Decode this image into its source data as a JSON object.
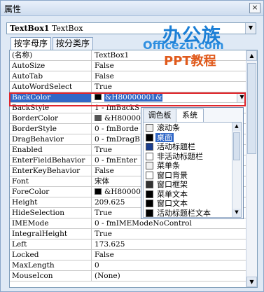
{
  "window": {
    "title": "属性",
    "close_label": "×"
  },
  "object_combo": {
    "name": "TextBox1",
    "type": "TextBox",
    "dropdown": "▼"
  },
  "tabs": [
    {
      "label": "按字母序",
      "active": true
    },
    {
      "label": "按分类序",
      "active": false
    }
  ],
  "properties": [
    {
      "name": "(名称)",
      "value": "TextBox1"
    },
    {
      "name": "AutoSize",
      "value": "False"
    },
    {
      "name": "AutoTab",
      "value": "False"
    },
    {
      "name": "AutoWordSelect",
      "value": "True"
    },
    {
      "name": "BackColor",
      "value": "&H80000001&",
      "swatch": "#000000",
      "selected": true
    },
    {
      "name": "BackStyle",
      "value": "1 - fmBackS"
    },
    {
      "name": "BorderColor",
      "value": "&H8000000",
      "swatch": "#555555"
    },
    {
      "name": "BorderStyle",
      "value": "0 - fmBorde"
    },
    {
      "name": "DragBehavior",
      "value": "0 - fmDragB"
    },
    {
      "name": "Enabled",
      "value": "True"
    },
    {
      "name": "EnterFieldBehavior",
      "value": "0 - fmEnter"
    },
    {
      "name": "EnterKeyBehavior",
      "value": "False"
    },
    {
      "name": "Font",
      "value": "宋体"
    },
    {
      "name": "ForeColor",
      "value": "&H8000000",
      "swatch": "#000000"
    },
    {
      "name": "Height",
      "value": "209.625"
    },
    {
      "name": "HideSelection",
      "value": "True"
    },
    {
      "name": "IMEMode",
      "value": "0 - fmIMEModeNoControl"
    },
    {
      "name": "IntegralHeight",
      "value": "True"
    },
    {
      "name": "Left",
      "value": "173.625"
    },
    {
      "name": "Locked",
      "value": "False"
    },
    {
      "name": "MaxLength",
      "value": "0"
    },
    {
      "name": "MouseIcon",
      "value": "(None)"
    }
  ],
  "color_popup": {
    "tabs": [
      {
        "label": "调色板",
        "active": false
      },
      {
        "label": "系统",
        "active": true
      }
    ],
    "items": [
      {
        "label": "滚动条",
        "color": "#f0f0f0"
      },
      {
        "label": "桌面",
        "color": "#000000",
        "selected": true
      },
      {
        "label": "活动标题栏",
        "color": "#1a3e8f"
      },
      {
        "label": "非活动标题栏",
        "color": "#ffffff"
      },
      {
        "label": "菜单条",
        "color": "#f0f0f0"
      },
      {
        "label": "窗口背景",
        "color": "#ffffff"
      },
      {
        "label": "窗口框架",
        "color": "#333333"
      },
      {
        "label": "菜单文本",
        "color": "#000000"
      },
      {
        "label": "窗口文本",
        "color": "#000000"
      },
      {
        "label": "活动标题栏文本",
        "color": "#000000"
      }
    ]
  },
  "watermark": {
    "main": "办公族",
    "domain": "Officezu.com",
    "sub": "PPT教程"
  },
  "colors": {
    "selection": "#3168c7",
    "highlight_border": "#e0252b",
    "logo_blue": "#1b7fd6",
    "logo_orange": "#e05a1c"
  },
  "icons": {
    "close": "close-icon",
    "dropdown": "chevron-down-icon"
  }
}
